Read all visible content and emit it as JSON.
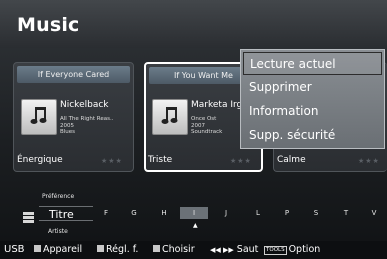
{
  "app": {
    "title": "Music"
  },
  "cards": [
    {
      "header": "If Everyone Cared",
      "artist": "Nickelback",
      "album": "All The Right Reas..",
      "year": "2005",
      "genre": "Blues",
      "mood": "Énergique",
      "stars": "★★★"
    },
    {
      "header": "If You Want Me",
      "artist": "Marketa Irg",
      "album": "Once Ost",
      "year": "2007",
      "genre": "Soundtrack",
      "mood": "Triste",
      "stars": "★★★"
    },
    {
      "header": "",
      "artist": "",
      "album": "",
      "year": "",
      "genre": "",
      "mood": "Calme",
      "stars": "★★★"
    }
  ],
  "context_menu": {
    "items": [
      "Lecture actuel",
      "Supprimer",
      "Information",
      "Supp. sécurité"
    ],
    "selected_index": 0
  },
  "sort": {
    "above": "Préférence",
    "current": "Titre",
    "below": "Artiste",
    "letters": [
      "F",
      "G",
      "H",
      "I",
      "J",
      "L",
      "P",
      "S",
      "T",
      "V"
    ],
    "selected_letter_index": 3,
    "arrow": "▲"
  },
  "bottom_bar": {
    "source": "USB",
    "appareil": "Appareil",
    "reglf": "Régl. f.",
    "choisir": "Choisir",
    "saut_icon": "◀◀ ▶▶",
    "saut": "Saut",
    "tools": "TOOLS",
    "option": "Option"
  },
  "icons": {
    "album_art": "music-note-icon",
    "sort": "list-bars-icon"
  }
}
